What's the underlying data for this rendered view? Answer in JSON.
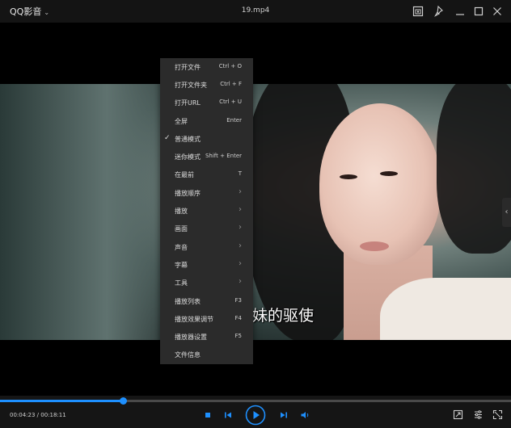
{
  "app": {
    "name": "QQ影音",
    "file_title": "19.mp4"
  },
  "titlebar_icons": [
    "screenshot-icon",
    "pin-icon",
    "minimize-icon",
    "maximize-icon",
    "close-icon"
  ],
  "subtitle": "妹的驱使",
  "context_menu": {
    "items": [
      {
        "label": "打开文件",
        "shortcut": "Ctrl + O"
      },
      {
        "label": "打开文件夹",
        "shortcut": "Ctrl + F"
      },
      {
        "label": "打开URL",
        "shortcut": "Ctrl + U"
      },
      {
        "label": "全屏",
        "shortcut": "Enter"
      },
      {
        "label": "普通模式",
        "checked": true
      },
      {
        "label": "迷你模式",
        "shortcut": "Shift + Enter"
      },
      {
        "label": "在最前",
        "shortcut": "T"
      },
      {
        "label": "播放顺序",
        "submenu": true
      },
      {
        "label": "播放",
        "submenu": true
      },
      {
        "label": "画面",
        "submenu": true
      },
      {
        "label": "声音",
        "submenu": true
      },
      {
        "label": "字幕",
        "submenu": true
      },
      {
        "label": "工具",
        "submenu": true
      },
      {
        "label": "播放列表",
        "shortcut": "F3"
      },
      {
        "label": "播放效果调节",
        "shortcut": "F4"
      },
      {
        "label": "播放器设置",
        "shortcut": "F5"
      },
      {
        "label": "文件信息"
      }
    ]
  },
  "playback": {
    "time_text": "00:04:23 / 00:18:11",
    "progress": 0.241,
    "state": "paused"
  },
  "colors": {
    "accent": "#1e90ff",
    "menu_bg": "#2b2b2b",
    "titlebar_bg": "#141414"
  }
}
